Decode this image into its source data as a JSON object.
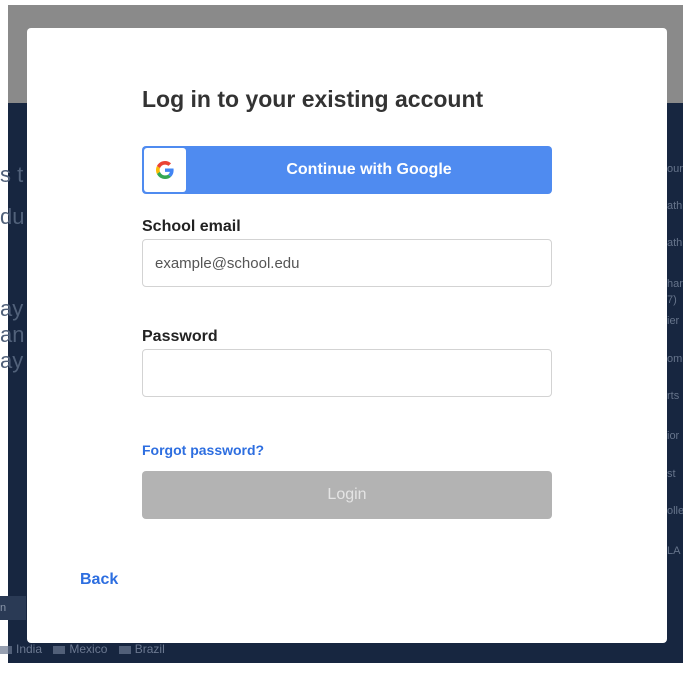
{
  "modal": {
    "title": "Log in to your existing account",
    "google_button": {
      "label": "Continue with Google",
      "icon": "google-g-icon"
    },
    "email": {
      "label": "School email",
      "placeholder": "example@school.edu",
      "value": ""
    },
    "password": {
      "label": "Password",
      "value": ""
    },
    "forgot_password": "Forgot password?",
    "login_button": {
      "label": "Login",
      "disabled": true
    },
    "back_link": "Back"
  },
  "background": {
    "left_snippets": [
      "s t",
      "du",
      "ay",
      "an",
      "ay"
    ],
    "right_snippets": [
      "our",
      "ath",
      "ath",
      "har",
      "7)",
      "ier",
      "om",
      "rts",
      "ior",
      "st",
      "olle",
      "LA"
    ],
    "left_box": "n",
    "countries": [
      "India",
      "Mexico",
      "Brazil"
    ]
  },
  "colors": {
    "primary_blue": "#4f8bf0",
    "link_blue": "#2d6ee0",
    "disabled_gray": "#b3b3b3",
    "backdrop_dark": "#172640",
    "backdrop_gray": "#8a8a8a"
  }
}
